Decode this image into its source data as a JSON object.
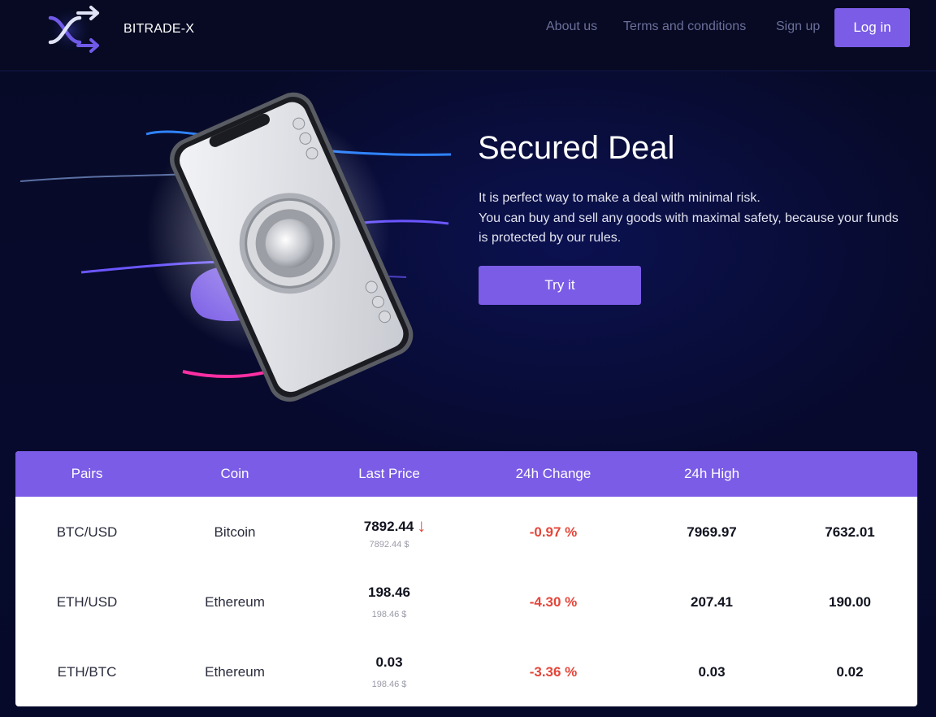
{
  "header": {
    "brand": "BITRADE-X",
    "nav": {
      "about": "About us",
      "terms": "Terms and conditions",
      "signup": "Sign up"
    },
    "login_label": "Log in"
  },
  "hero": {
    "title": "Secured Deal",
    "lines": [
      "It is perfect way to make a deal with minimal risk.",
      "You can buy and sell any goods with maximal safety, because your funds",
      "is protected by our rules."
    ],
    "cta_label": "Try it"
  },
  "table": {
    "headers": [
      "Pairs",
      "Coin",
      "Last Price",
      "24h Change",
      "24h High"
    ],
    "rows": [
      {
        "pair": "BTC/USD",
        "coin": "Bitcoin",
        "price": "7892.44",
        "price_sub": "7892.44 $",
        "trend": "down",
        "change": "-0.97 %",
        "high": "7969.97",
        "low": "7632.01"
      },
      {
        "pair": "ETH/USD",
        "coin": "Ethereum",
        "price": "198.46",
        "price_sub": "198.46 $",
        "trend": "",
        "change": "-4.30 %",
        "high": "207.41",
        "low": "190.00"
      },
      {
        "pair": "ETH/BTC",
        "coin": "Ethereum",
        "price": "0.03",
        "price_sub": "198.46 $",
        "trend": "",
        "change": "-3.36 %",
        "high": "0.03",
        "low": "0.02"
      }
    ]
  },
  "colors": {
    "accent": "#7a5ce6",
    "background": "#06092a",
    "negative": "#e4463a"
  },
  "icons": {
    "logo": "shuffle-arrows-icon",
    "trend_down": "arrow-down-icon"
  }
}
